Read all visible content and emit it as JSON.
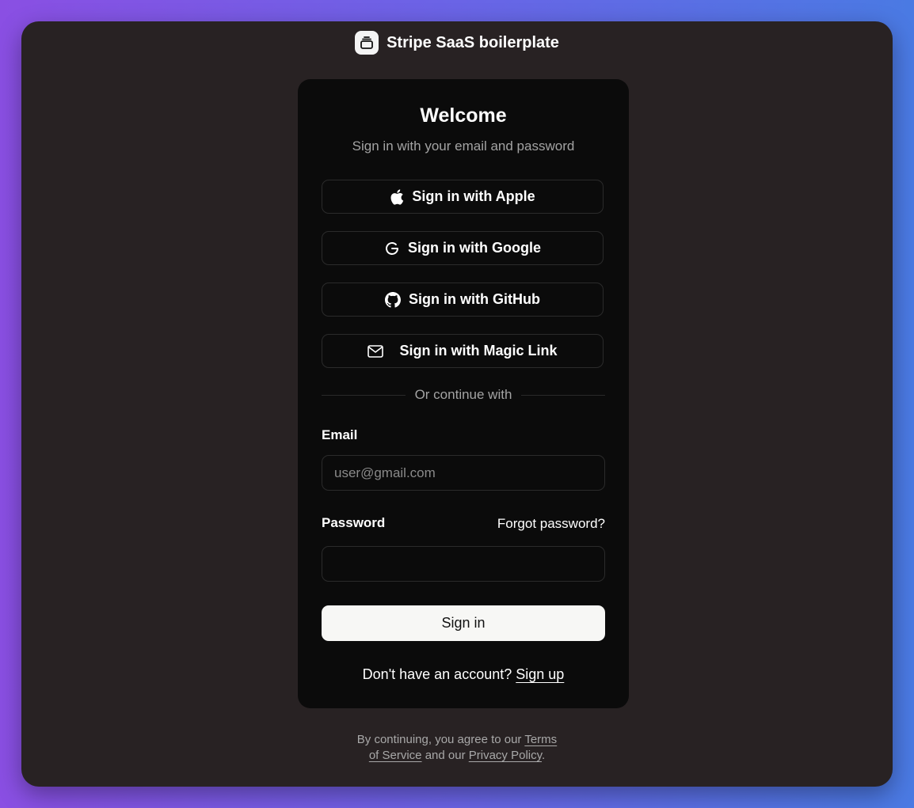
{
  "brand": {
    "name": "Stripe SaaS boilerplate"
  },
  "card": {
    "title": "Welcome",
    "subtitle": "Sign in with your email and password"
  },
  "social": {
    "apple": "Sign in with Apple",
    "google": "Sign in with Google",
    "github": "Sign in with GitHub",
    "magic": "Sign in with Magic Link"
  },
  "divider": {
    "text": "Or continue with"
  },
  "form": {
    "email_label": "Email",
    "email_placeholder": "user@gmail.com",
    "password_label": "Password",
    "forgot_label": "Forgot password?",
    "submit_label": "Sign in"
  },
  "signup": {
    "prompt": "Don't have an account?",
    "link": "Sign up"
  },
  "footer": {
    "text1": "By continuing, you agree to our",
    "terms_word1": "Terms",
    "terms_word2": "of Service",
    "and_text": "and our",
    "privacy": "Privacy Policy",
    "period": "."
  },
  "colors": {
    "background_gradient_start": "#8a4fe3",
    "background_gradient_end": "#4a7ae3",
    "window": "#282223",
    "card": "#0b0b0b",
    "submit_button": "#f7f7f5"
  }
}
